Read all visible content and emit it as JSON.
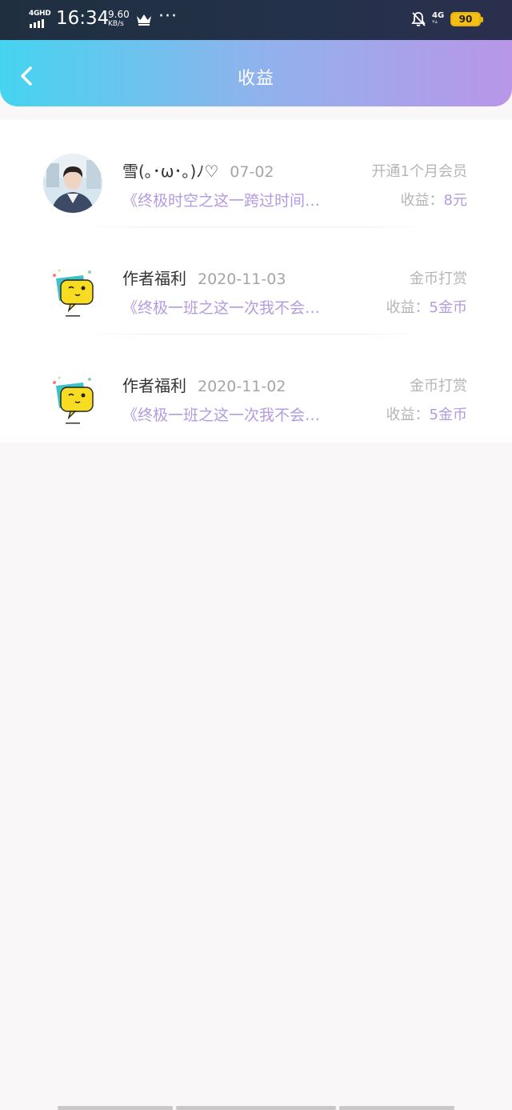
{
  "status_bar": {
    "network_tag": "4GHD",
    "time": "16:34",
    "speed_value": "9.60",
    "speed_unit": "KB/s",
    "more_icon": "more-dots-icon",
    "crown_icon": "crown-icon",
    "bell_icon": "bell-off-icon",
    "net2": "4G",
    "battery": "90"
  },
  "header": {
    "title": "收益",
    "back_icon": "chevron-left-icon"
  },
  "rows": [
    {
      "name": "雪(｡･ω･｡)ﾉ♡",
      "date": "07-02",
      "book": "《终极时空之这一跨过时间…",
      "type": "开通1个月会员",
      "earn_label": "收益：",
      "earn_amount": "8元",
      "avatar": "user-photo-avatar"
    },
    {
      "name": "作者福利",
      "date": "2020-11-03",
      "book": "《终极一班之这一次我不会…",
      "type": "金币打赏",
      "earn_label": "收益：",
      "earn_amount": "5金币",
      "avatar": "chat-bubble-mascot-avatar"
    },
    {
      "name": "作者福利",
      "date": "2020-11-02",
      "book": "《终极一班之这一次我不会…",
      "type": "金币打赏",
      "earn_label": "收益：",
      "earn_amount": "5金币",
      "avatar": "chat-bubble-mascot-avatar"
    }
  ],
  "colors": {
    "header_gradient_start": "#45d4f0",
    "header_gradient_end": "#b996e8",
    "accent_purple": "#b49be0",
    "muted_gray": "#b5b5b5"
  }
}
